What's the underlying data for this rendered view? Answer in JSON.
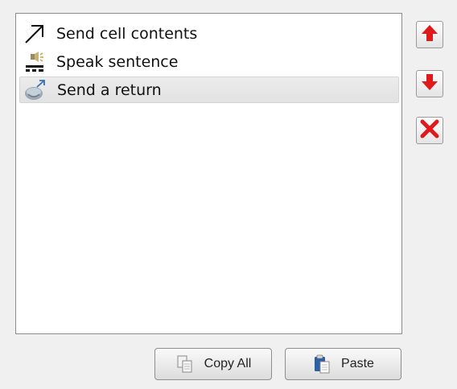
{
  "list": {
    "items": [
      {
        "label": "Send cell contents",
        "icon": "arrow-up-right-icon",
        "selected": false
      },
      {
        "label": "Speak sentence",
        "icon": "speak-icon",
        "selected": false
      },
      {
        "label": "Send a return",
        "icon": "send-return-icon",
        "selected": true
      }
    ]
  },
  "side_buttons": {
    "move_up_icon": "arrow-up-icon",
    "move_down_icon": "arrow-down-icon",
    "delete_icon": "close-icon",
    "accent_color": "#e01a1a"
  },
  "buttons": {
    "copy_all_label": "Copy All",
    "paste_label": "Paste"
  }
}
